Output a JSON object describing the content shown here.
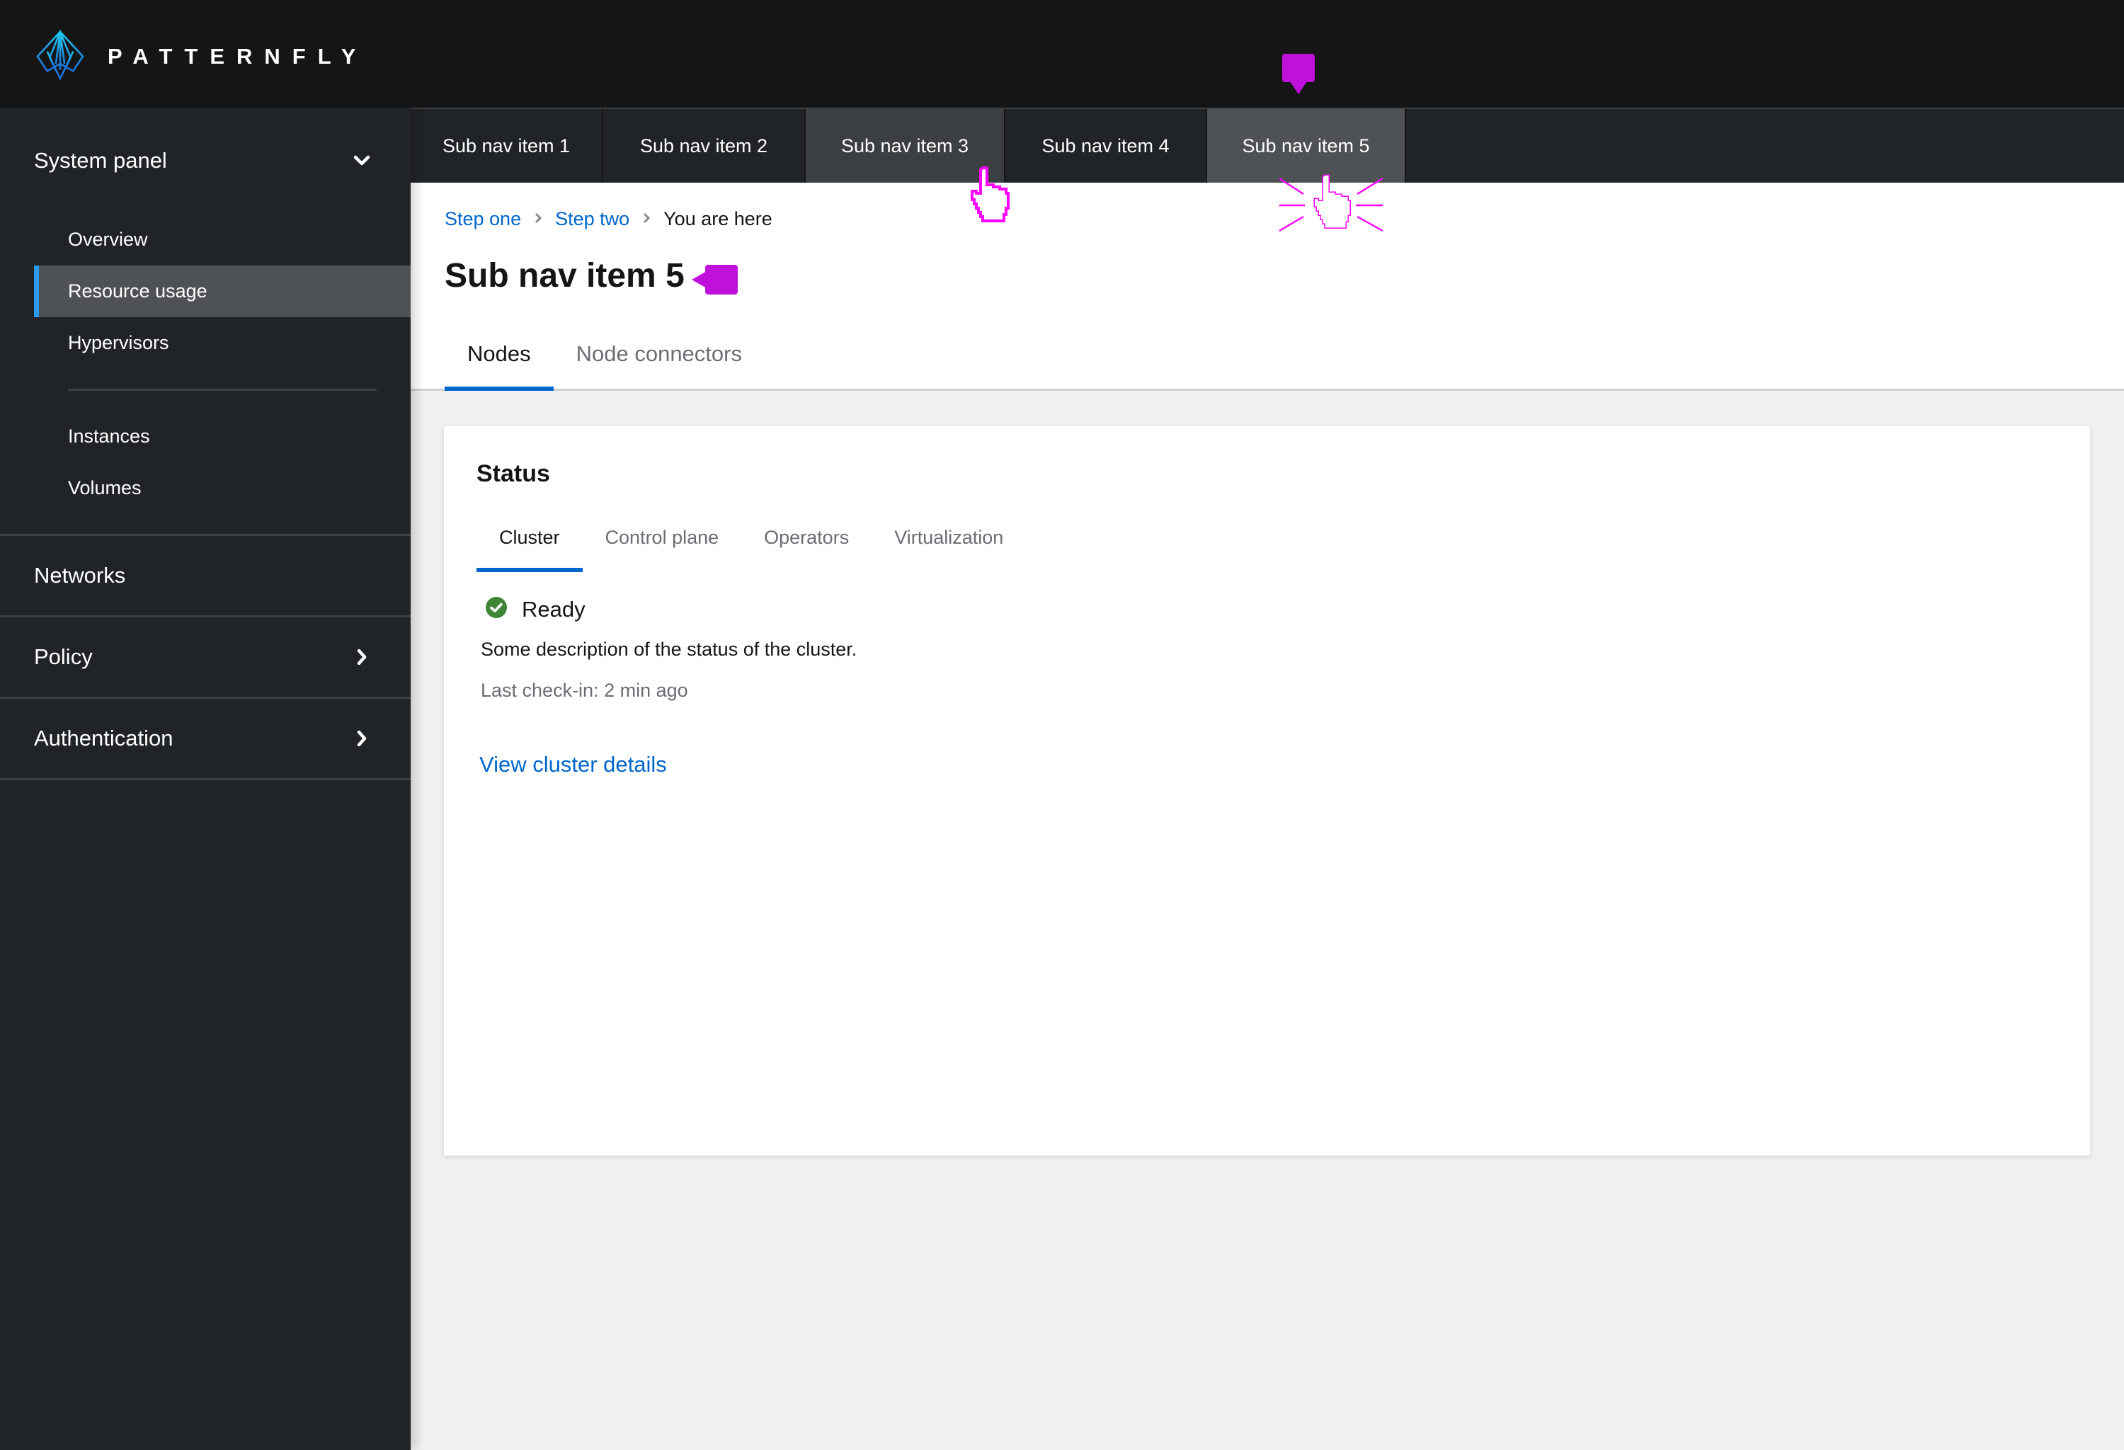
{
  "masthead": {
    "brand": "PATTERNFLY",
    "logo_icon": "patternfly-logo-icon"
  },
  "sidebar": {
    "system_panel": {
      "label": "System panel",
      "expanded": true,
      "icon": "chevron-down-icon",
      "items": [
        {
          "label": "Overview",
          "active": false
        },
        {
          "label": "Resource usage",
          "active": true
        },
        {
          "label": "Hypervisors",
          "active": false
        },
        {
          "label": "Instances",
          "active": false
        },
        {
          "label": "Volumes",
          "active": false
        }
      ]
    },
    "sections": [
      {
        "label": "Networks",
        "icon": null
      },
      {
        "label": "Policy",
        "icon": "chevron-right-icon"
      },
      {
        "label": "Authentication",
        "icon": "chevron-right-icon"
      }
    ]
  },
  "subnav": {
    "items": [
      {
        "label": "Sub nav item 1"
      },
      {
        "label": "Sub nav item 2"
      },
      {
        "label": "Sub nav item 3",
        "state": "hover"
      },
      {
        "label": "Sub nav item 4"
      },
      {
        "label": "Sub nav item 5",
        "state": "current"
      }
    ]
  },
  "breadcrumb": {
    "items": [
      {
        "label": "Step one",
        "link": true
      },
      {
        "label": "Step two",
        "link": true
      },
      {
        "label": "You are here",
        "link": false
      }
    ]
  },
  "page": {
    "title": "Sub nav item 5",
    "tabs": [
      {
        "label": "Nodes",
        "active": true
      },
      {
        "label": "Node connectors",
        "active": false
      }
    ]
  },
  "card": {
    "title": "Status",
    "tabs": [
      {
        "label": "Cluster",
        "active": true
      },
      {
        "label": "Control plane",
        "active": false
      },
      {
        "label": "Operators",
        "active": false
      },
      {
        "label": "Virtualization",
        "active": false
      }
    ],
    "status": {
      "icon": "check-circle-icon",
      "label": "Ready",
      "description": "Some description of the status of the cluster.",
      "last_checkin": "Last check-in: 2 min ago"
    },
    "link_label": "View cluster details"
  },
  "colors": {
    "masthead_bg": "#151515",
    "sidebar_bg": "#212427",
    "active_item_bg": "#4f5255",
    "accent_blue": "#0066cc",
    "active_indicator": "#2b9af3",
    "success_green": "#3e8635",
    "annotation_magenta": "#c010dc"
  }
}
